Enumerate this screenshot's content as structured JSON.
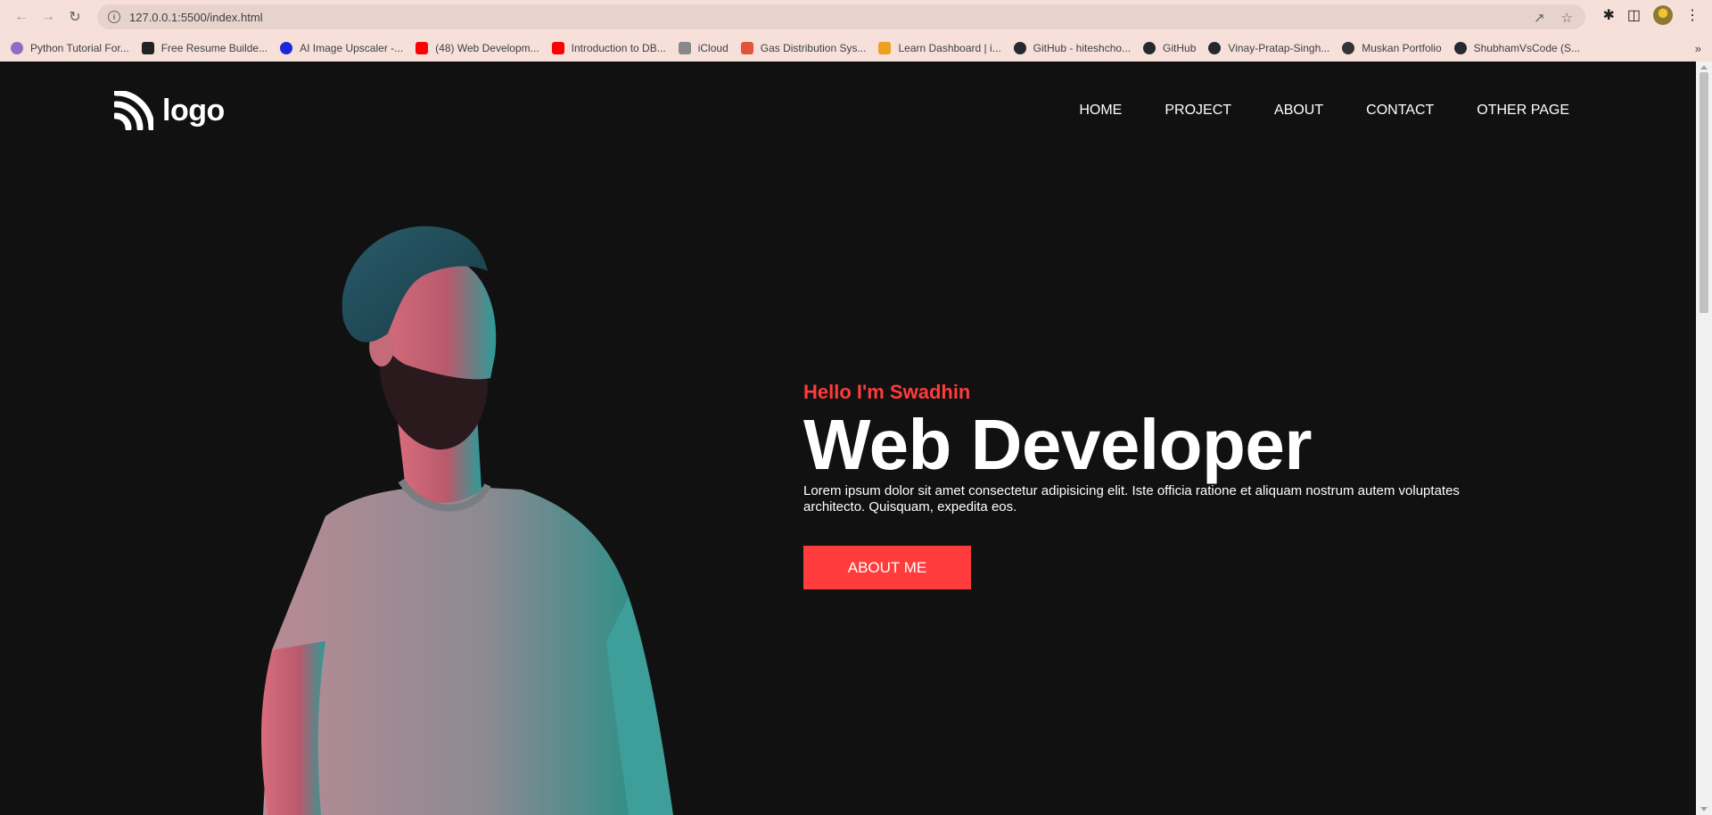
{
  "browser": {
    "url": "127.0.0.1:5500/index.html",
    "bookmarks": [
      {
        "label": "Python Tutorial For...",
        "icon": "person-favicon",
        "color": "#8e6cc7"
      },
      {
        "label": "Free Resume Builde...",
        "icon": "bird-favicon",
        "color": "#222222"
      },
      {
        "label": "AI Image Upscaler -...",
        "icon": "u-circle-favicon",
        "color": "#1a2ad6"
      },
      {
        "label": "(48) Web Developm...",
        "icon": "youtube-favicon",
        "color": "#ff0000"
      },
      {
        "label": "Introduction to DB...",
        "icon": "youtube-favicon",
        "color": "#ff0000"
      },
      {
        "label": "iCloud",
        "icon": "apple-favicon",
        "color": "#888888"
      },
      {
        "label": "Gas Distribution Sys...",
        "icon": "pinwheel-favicon",
        "color": "#e0553a"
      },
      {
        "label": "Learn Dashboard | i...",
        "icon": "learn-favicon",
        "color": "#f0a020"
      },
      {
        "label": "GitHub - hiteshcho...",
        "icon": "github-favicon",
        "color": "#24292f"
      },
      {
        "label": "GitHub",
        "icon": "github-favicon",
        "color": "#24292f"
      },
      {
        "label": "Vinay-Pratap-Singh...",
        "icon": "github-favicon",
        "color": "#24292f"
      },
      {
        "label": "Muskan Portfolio",
        "icon": "globe-favicon",
        "color": "#333333"
      },
      {
        "label": "ShubhamVsCode (S...",
        "icon": "github-favicon",
        "color": "#24292f"
      }
    ]
  },
  "site": {
    "logo_text": "logo",
    "nav": [
      "HOME",
      "PROJECT",
      "ABOUT",
      "CONTACT",
      "OTHER PAGE"
    ],
    "hero": {
      "greeting": "Hello I'm Swadhin",
      "title": "Web Developer",
      "description": "Lorem ipsum dolor sit amet consectetur adipisicing elit. Iste officia ratione et aliquam nostrum autem voluptates architecto. Quisquam, expedita eos.",
      "cta_label": "ABOUT ME"
    }
  },
  "colors": {
    "accent": "#ff3c3c",
    "background": "#111111",
    "browser_chrome": "#f6e0d9"
  }
}
